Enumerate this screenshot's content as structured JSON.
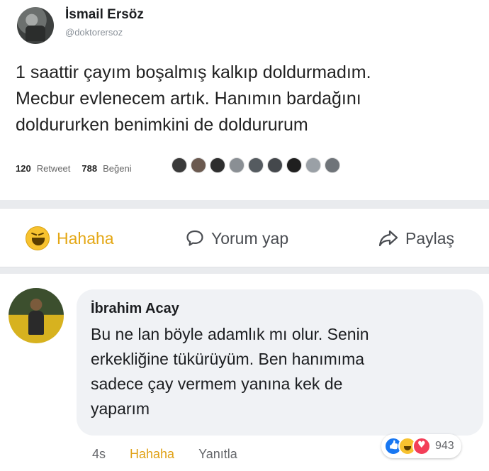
{
  "tweet": {
    "author_name": "İsmail Ersöz",
    "author_handle": "@doktorersoz",
    "text_lines": [
      "1 saattir çayım boşalmış kalkıp doldurmadım.",
      "Mecbur evlenecem artık. Hanımın bardağını",
      "doldururken benimkini de doldururum"
    ],
    "retweet_count": "120",
    "retweet_label": "Retweet",
    "like_count": "788",
    "like_label": "Beğeni",
    "liker_avatar_count_icons": [
      "avatar-icon",
      "avatar-icon",
      "avatar-icon",
      "avatar-icon",
      "avatar-icon",
      "avatar-icon",
      "avatar-icon",
      "avatar-icon",
      "avatar-icon"
    ]
  },
  "actions": {
    "haha_label": "Hahaha",
    "comment_label": "Yorum yap",
    "share_label": "Paylaş"
  },
  "comment": {
    "author_name": "İbrahim Acay",
    "text_lines": [
      "Bu ne lan böyle adamlık mı olur. Senin",
      "erkekliğine tükürüyüm. Ben hanımıma",
      "sadece çay vermem yanına kek de",
      "yaparım"
    ],
    "time": "4s",
    "haha_label": "Hahaha",
    "reply_label": "Yanıtla",
    "reaction_count": "943",
    "reaction_icons": [
      "like-icon",
      "haha-icon",
      "love-icon"
    ]
  },
  "colors": {
    "haha_accent": "#e4a714",
    "like_blue": "#1877f2",
    "love_red": "#f33e58",
    "bubble_bg": "#f0f2f5"
  }
}
